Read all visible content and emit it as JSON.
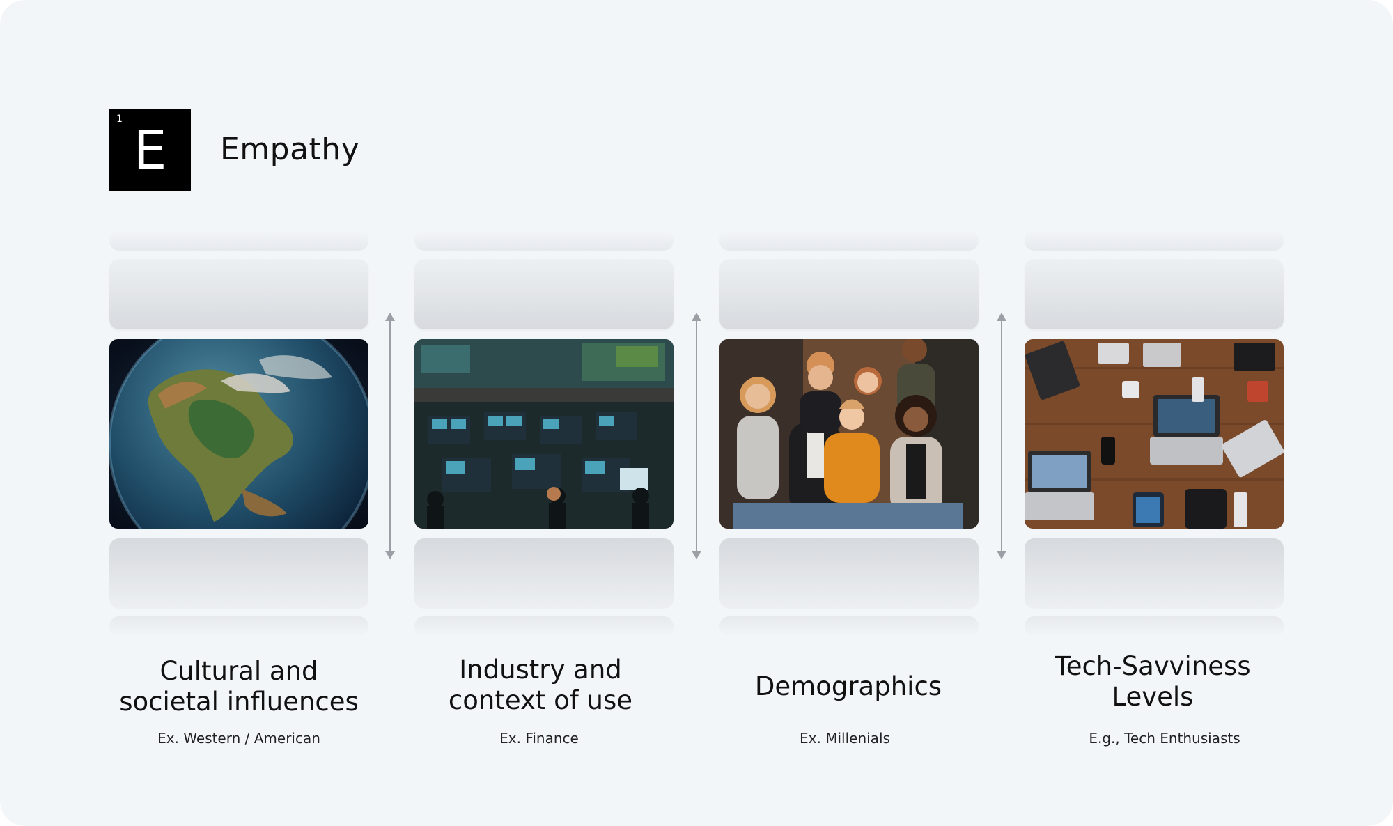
{
  "brand": {
    "badge_number": "1",
    "badge_letter": "E",
    "title": "Empathy"
  },
  "columns": [
    {
      "label_line1": "Cultural and",
      "label_line2": "societal influences",
      "example": "Ex. Western / American",
      "image": "earth-globe-image"
    },
    {
      "label_line1": "Industry and",
      "label_line2": "context of use",
      "example": "Ex. Finance",
      "image": "trading-floor-image"
    },
    {
      "label_line1": "Demographics",
      "label_line2": "",
      "example": "Ex. Millenials",
      "image": "group-of-people-image"
    },
    {
      "label_line1": "Tech-Savviness",
      "label_line2": "Levels",
      "example": "E.g., Tech Enthusiasts",
      "image": "tech-devices-flatlay-image"
    }
  ],
  "colors": {
    "background": "#f3f6f9",
    "badge": "#000000",
    "text": "#111111",
    "arrow": "#9aa0a6"
  }
}
